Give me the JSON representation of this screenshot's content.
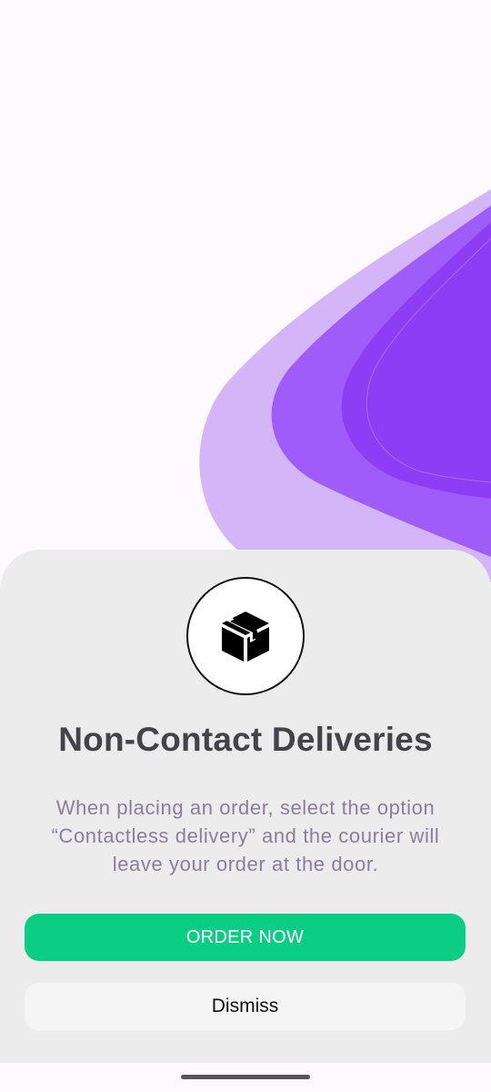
{
  "onboarding": {
    "icon": "package-box-icon",
    "title": "Non-Contact Deliveries",
    "description": "When placing an order, select the option “Contactless delivery” and the courier will leave your order at the door.",
    "primary_button": "ORDER NOW",
    "secondary_button": "Dismiss"
  },
  "colors": {
    "background": "#fdf9fd",
    "sheet": "#ececec",
    "accent_green": "#0bcd84",
    "purple_light": "#d4b6f8",
    "purple_mid": "#a05cf9",
    "purple_dark": "#8d3ef5",
    "title_text": "#45434a",
    "description_text": "#8c7d9e"
  }
}
